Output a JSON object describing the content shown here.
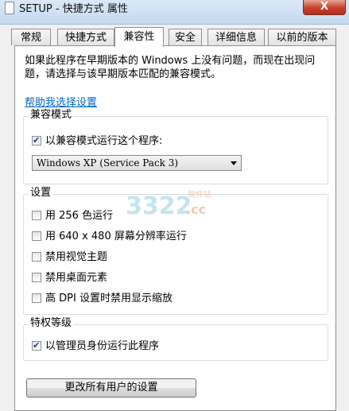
{
  "window": {
    "title": "SETUP - 快捷方式 属性",
    "close_label": "X"
  },
  "tabs": [
    {
      "label": "常规"
    },
    {
      "label": "快捷方式"
    },
    {
      "label": "兼容性",
      "active": true
    },
    {
      "label": "安全"
    },
    {
      "label": "详细信息"
    },
    {
      "label": "以前的版本"
    }
  ],
  "compat": {
    "description": "如果此程序在早期版本的 Windows 上没有问题，而现在出现问题，请选择与该早期版本匹配的兼容模式。",
    "help_link": "帮助我选择设置",
    "mode_group": {
      "title": "兼容模式",
      "checkbox_label": "以兼容模式运行这个程序:",
      "checked": true,
      "selected_os": "Windows XP (Service Pack 3)"
    },
    "settings_group": {
      "title": "设置",
      "items": [
        {
          "label": "用 256 色运行",
          "checked": false
        },
        {
          "label": "用 640 x 480 屏幕分辨率运行",
          "checked": false
        },
        {
          "label": "禁用视觉主题",
          "checked": false
        },
        {
          "label": "禁用桌面元素",
          "checked": false
        },
        {
          "label": "高 DPI 设置时禁用显示缩放",
          "checked": false
        }
      ]
    },
    "privilege_group": {
      "title": "特权等级",
      "checkbox_label": "以管理员身份运行此程序",
      "checked": true
    },
    "all_users_button": "更改所有用户的设置"
  },
  "watermark": {
    "number": "3322",
    "suffix": ".cc",
    "caption": "软件站"
  }
}
